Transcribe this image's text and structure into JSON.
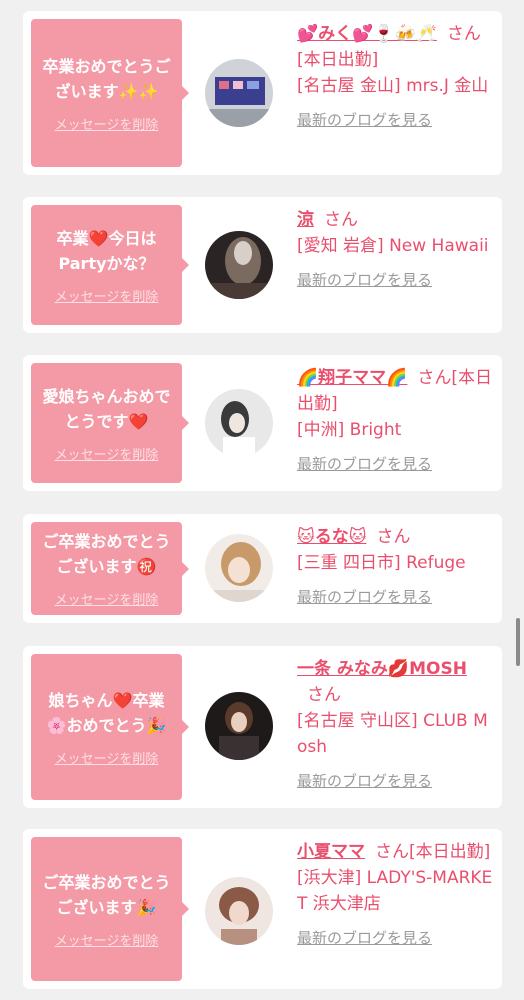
{
  "messages": [
    {
      "bubble": "卒業おめでとうございます✨✨",
      "delete": "メッセージを削除",
      "name": "💕みく💕🍷🍻🥂",
      "suffix": "さん[本日出勤]",
      "location": "[名古屋 金山] mrs.J 金山",
      "blog": "最新のブログを見る"
    },
    {
      "bubble": "卒業❤️今日はPartyかな？",
      "delete": "メッセージを削除",
      "name": "涼",
      "suffix": "さん",
      "location": "[愛知 岩倉] New Hawaii",
      "blog": "最新のブログを見る"
    },
    {
      "bubble": "愛娘ちゃんおめでとうです❤️",
      "delete": "メッセージを削除",
      "name": "🌈翔子ママ🌈",
      "suffix": "さん[本日出勤]",
      "location": "[中洲] Bright",
      "blog": "最新のブログを見る"
    },
    {
      "bubble": "ご卒業おめでとうございます㊗️",
      "delete": "メッセージを削除",
      "name": "🐱るな🐱",
      "suffix": "さん",
      "location": "[三重 四日市] Refuge",
      "blog": "最新のブログを見る"
    },
    {
      "bubble": "娘ちゃん❤️卒業🌸おめでとう🎉",
      "delete": "メッセージを削除",
      "name": "一条 みなみ💋MOSH",
      "suffix": "さん",
      "location": "[名古屋 守山区] CLUB Mosh",
      "blog": "最新のブログを見る"
    },
    {
      "bubble": "ご卒業おめでとうございます🎉",
      "delete": "メッセージを削除",
      "name": "小夏ママ",
      "suffix": "さん[本日出勤]",
      "location": "[浜大津] LADY'S-MARKET 浜大津店",
      "blog": "最新のブログを見る"
    }
  ],
  "colors": {
    "bubble": "#f49aa6",
    "accent_text": "#e94f6d",
    "link_gray": "#9a9a9a",
    "background": "#f0f0f0"
  }
}
